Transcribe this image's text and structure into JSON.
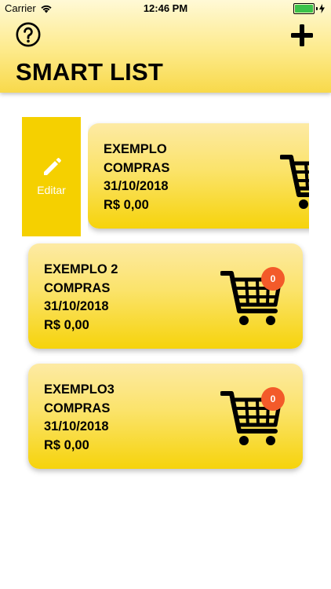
{
  "status_bar": {
    "carrier": "Carrier",
    "time": "12:46 PM"
  },
  "header": {
    "title": "SMART LIST",
    "help_icon": "question-circle-icon",
    "add_icon": "plus-icon"
  },
  "edit_action": {
    "label": "Editar",
    "icon": "pencil-icon"
  },
  "lists": [
    {
      "line1": "EXEMPLO",
      "line2": "COMPRAS",
      "date": "31/10/2018",
      "total": "R$ 0,00"
    },
    {
      "line1": "EXEMPLO 2",
      "line2": "COMPRAS",
      "date": "31/10/2018",
      "total": "R$ 0,00",
      "badge": "0"
    },
    {
      "line1": "EXEMPLO3",
      "line2": "COMPRAS",
      "date": "31/10/2018",
      "total": "R$ 0,00",
      "badge": "0"
    }
  ],
  "colors": {
    "accent": "#f5d000",
    "badge": "#f35a2a"
  }
}
